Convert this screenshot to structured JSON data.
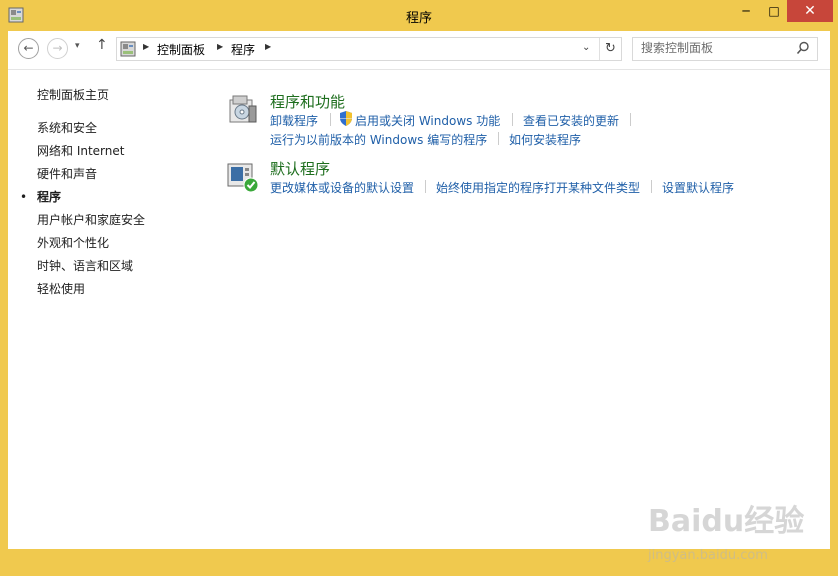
{
  "window": {
    "title": "程序",
    "minimize_label": "─",
    "maximize_label": "□",
    "close_label": "✕"
  },
  "nav": {
    "back_label": "←",
    "forward_label": "→",
    "history_label": "▾",
    "up_label": "↑",
    "breadcrumb": [
      "控制面板",
      "程序"
    ],
    "arrow": "▶",
    "address_dropdown": "⌄",
    "refresh_label": "↻",
    "search_placeholder": "搜索控制面板"
  },
  "sidebar": {
    "home": "控制面板主页",
    "items": [
      "系统和安全",
      "网络和 Internet",
      "硬件和声音",
      "程序",
      "用户帐户和家庭安全",
      "外观和个性化",
      "时钟、语言和区域",
      "轻松使用"
    ],
    "active_index": 3,
    "active_bullet": "•"
  },
  "categories": [
    {
      "title": "程序和功能",
      "links_row1": [
        "卸载程序",
        "启用或关闭 Windows 功能",
        "查看已安装的更新"
      ],
      "links_row2": [
        "运行为以前版本的 Windows 编写的程序",
        "如何安装程序"
      ]
    },
    {
      "title": "默认程序",
      "links_row1": [
        "更改媒体或设备的默认设置",
        "始终使用指定的程序打开某种文件类型",
        "设置默认程序"
      ]
    }
  ],
  "watermark": {
    "brand": "Baidu经验",
    "url": "jingyan.baidu.com"
  },
  "colors": {
    "window_frame": "#f0c94e",
    "close_button": "#c7463a",
    "link": "#1f5fa8",
    "category_title": "#1e6e1e"
  }
}
